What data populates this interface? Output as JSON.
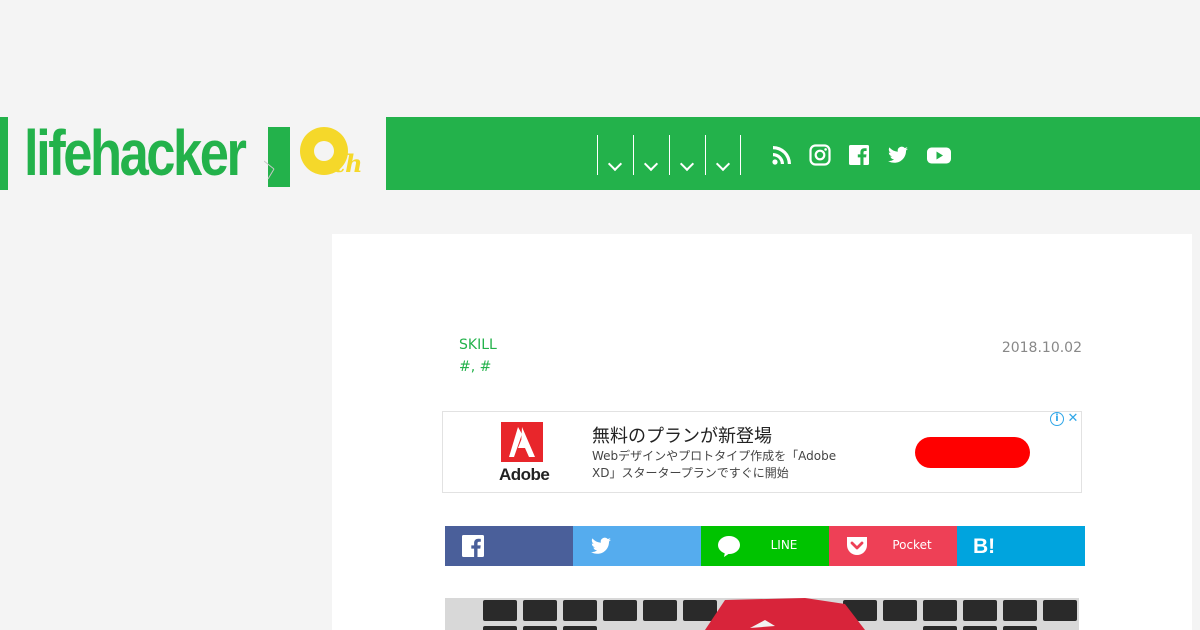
{
  "header": {
    "logo": {
      "text": "lifehacker",
      "badge": "10",
      "badge_suffix": "th"
    },
    "nav": {
      "dropdowns": [
        "menu-1",
        "menu-2",
        "menu-3",
        "menu-4"
      ],
      "social": [
        "rss-icon",
        "instagram-icon",
        "facebook-icon",
        "twitter-icon",
        "youtube-icon"
      ]
    }
  },
  "article": {
    "category": "SKILL",
    "tags": "#, #",
    "date": "2018.10.02"
  },
  "ad": {
    "brand": "Adobe",
    "title": "無料のプランが新登場",
    "body": "Webデザインやプロトタイプ作成を「Adobe XD」スタータープランですぐに開始",
    "info": "i",
    "close": "✕"
  },
  "share": {
    "facebook_label": "",
    "twitter_label": "",
    "line_label": "LINE",
    "pocket_label": "Pocket",
    "hatena_label": "",
    "colors": {
      "facebook": "#4a5f9a",
      "twitter": "#55acee",
      "line": "#00c300",
      "pocket": "#ee4056",
      "hatena": "#00a4de"
    }
  },
  "theme": {
    "accent": "#23b24b",
    "ten_yellow": "#f5d82a"
  }
}
